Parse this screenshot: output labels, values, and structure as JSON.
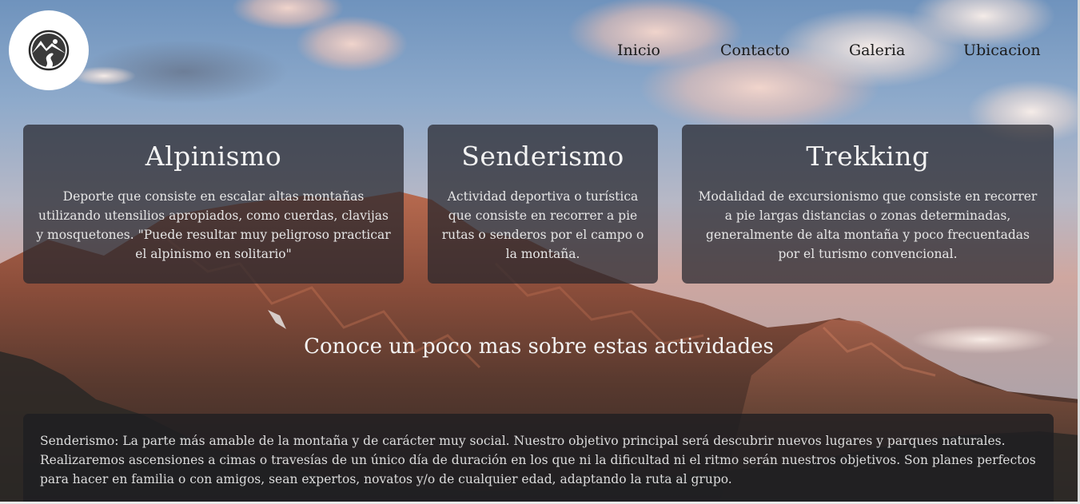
{
  "logo": {
    "icon": "mountain-river-logo-icon"
  },
  "nav": {
    "items": [
      {
        "label": "Inicio"
      },
      {
        "label": "Contacto"
      },
      {
        "label": "Galeria"
      },
      {
        "label": "Ubicacion"
      }
    ]
  },
  "cards": [
    {
      "title": "Alpinismo",
      "text": "Deporte que consiste en escalar altas montañas utilizando utensilios apropiados, como cuerdas, clavijas y mosquetones. \"Puede resultar muy peligroso practicar el alpinismo en solitario\""
    },
    {
      "title": "Senderismo",
      "text": "Actividad deportiva o turística que consiste en recorrer a pie rutas o senderos por el campo o la montaña."
    },
    {
      "title": "Trekking",
      "text": "Modalidad de excursionismo que consiste en recorrer a pie largas distancias o zonas determinadas, generalmente de alta montaña y poco frecuentadas por el turismo convencional."
    }
  ],
  "section": {
    "title": "Conoce un poco mas sobre estas actividades"
  },
  "info": {
    "text": "Senderismo: La parte más amable de la montaña y de carácter muy social. Nuestro objetivo principal será descubrir nuevos lugares y parques naturales. Realizaremos ascensiones a cimas o travesías de un único día de duración en los que ni la dificultad ni el ritmo serán nuestros objetivos. Son planes perfectos para hacer en familia o con amigos, sean expertos, novatos y/o de cualquier edad, adaptando la ruta al grupo."
  }
}
